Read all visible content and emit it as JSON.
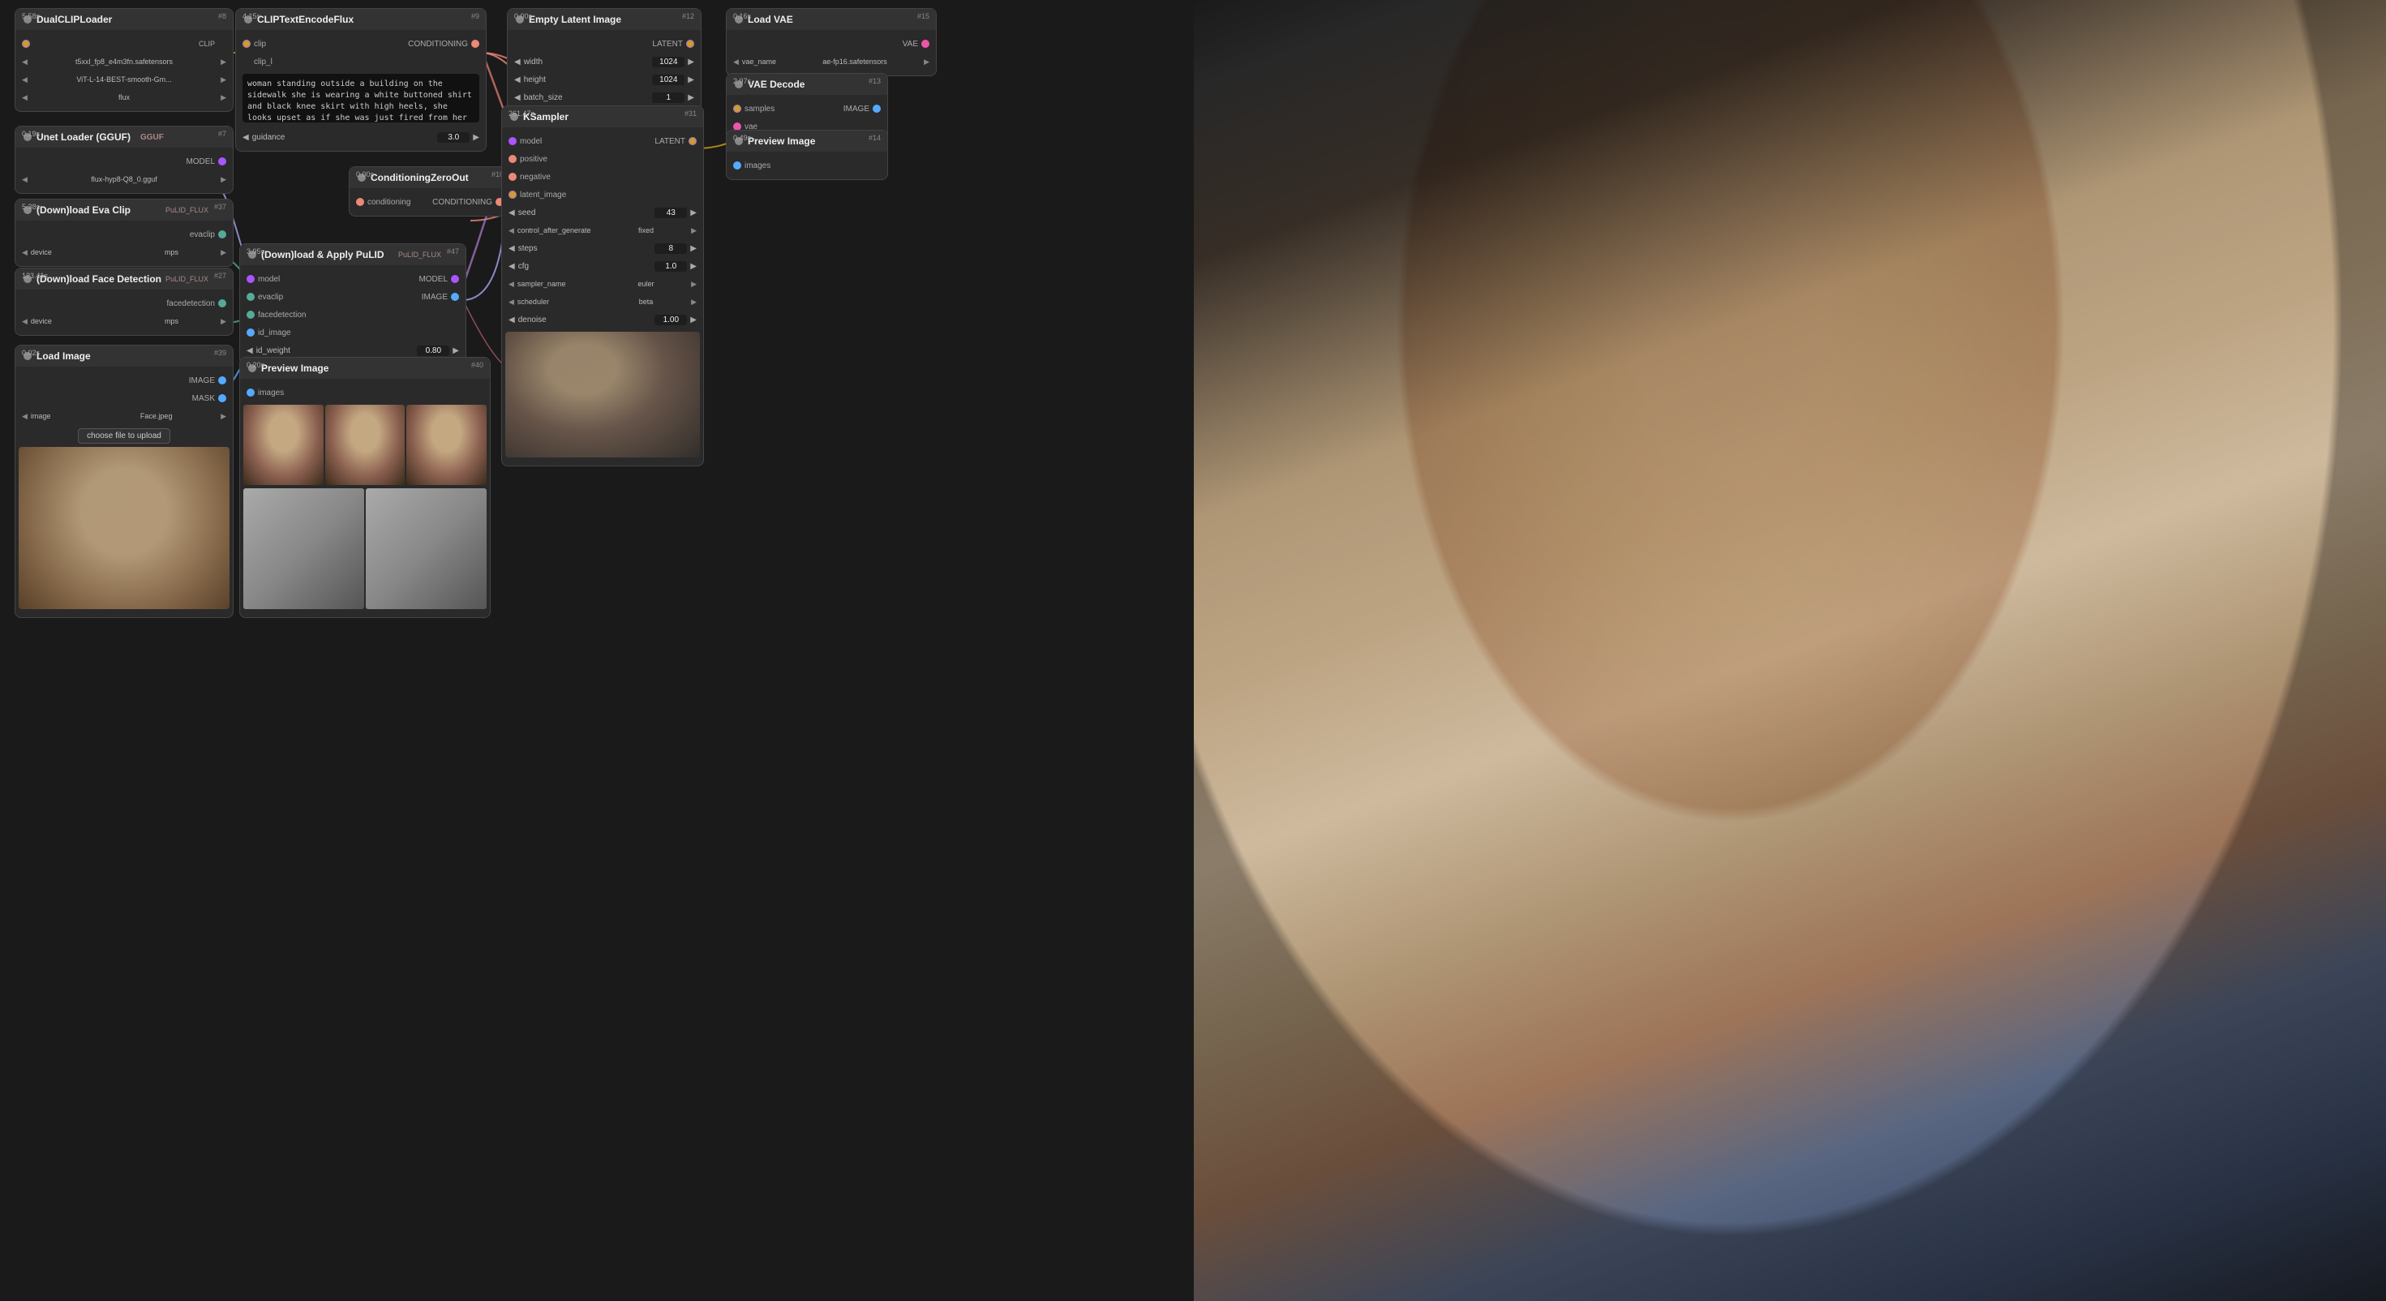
{
  "nodes": {
    "dual_clip": {
      "id": "#8",
      "time": "5.58s",
      "title": "DualCLIPLoader",
      "clip_name1": "t5xxl_fp8_e4m3fn.safetensors",
      "clip_name2": "ViT-L-14-BEST-smooth-Gm...",
      "type": "flux"
    },
    "clip_text": {
      "id": "#9",
      "time": "4.15s",
      "title": "CLIPTextEncodeFlux",
      "clip_port": "clip",
      "clip_l_port": "clip_l",
      "prompt": "woman standing outside a building on the sidewalk she is wearing a white buttoned shirt and black knee skirt with high heels, she looks upset as if she was just fired from her job",
      "guidance_label": "guidance",
      "guidance_val": "3.0"
    },
    "gguf": {
      "id": "#7",
      "time": "0.19s",
      "title": "Unet Loader (GGUF)",
      "unet_name": "flux-hyp8-Q8_0.gguf",
      "label": "GGUF"
    },
    "eva_clip": {
      "id": "#37",
      "time": "5.38s",
      "title": "(Down)load Eva Clip",
      "label": "PuLID_FLUX",
      "evaclip_port": "evaclip",
      "device_label": "device",
      "device_val": "mps"
    },
    "face_detect": {
      "id": "#27",
      "time": "123.41s",
      "title": "(Down)load Face Detection",
      "label": "PuLID_FLUX",
      "facedetection_port": "facedetection",
      "device_label": "device",
      "device_val": "mps"
    },
    "load_image": {
      "id": "#39",
      "time": "0.02s",
      "title": "Load Image",
      "image_label": "image",
      "image_val": "Face.jpeg",
      "upload_label": "choose file to upload"
    },
    "conditioning_zero": {
      "id": "#10",
      "time": "0.00s",
      "title": "ConditioningZeroOut",
      "conditioning_label": "conditioning",
      "conditioning_type": "CONDITIONING"
    },
    "apply_pulid": {
      "id": "#47",
      "time": "3.95s",
      "title": "(Down)load & Apply PuLID",
      "label": "PuLID_FLUX",
      "model_label": "model",
      "evaclip_label": "evaclip",
      "facedetection_label": "facedetection",
      "id_image_label": "id_image",
      "id_weight_label": "id_weight",
      "id_weight_val": "0.80",
      "model_out": "MODEL",
      "image_out": "IMAGE"
    },
    "empty_latent": {
      "id": "#12",
      "time": "0.00s",
      "title": "Empty Latent Image",
      "width_label": "width",
      "width_val": "1024",
      "height_label": "height",
      "height_val": "1024",
      "batch_label": "batch_size",
      "batch_val": "1",
      "latent_out": "LATENT"
    },
    "ksampler": {
      "id": "#31",
      "time": "261.47s",
      "title": "KSampler",
      "model_label": "model",
      "positive_label": "positive",
      "negative_label": "negative",
      "latent_label": "latent_image",
      "seed_label": "seed",
      "seed_val": "43",
      "control_label": "control_after_generate",
      "control_val": "fixed",
      "steps_label": "steps",
      "steps_val": "8",
      "cfg_label": "cfg",
      "cfg_val": "1.0",
      "sampler_label": "sampler_name",
      "sampler_val": "euler",
      "scheduler_label": "scheduler",
      "scheduler_val": "beta",
      "denoise_label": "denoise",
      "denoise_val": "1.00",
      "latent_out": "LATENT"
    },
    "load_vae": {
      "id": "#15",
      "time": "0.16s",
      "title": "Load VAE",
      "vae_name_label": "vae_name",
      "vae_name_val": "ae-fp16.safetensors",
      "vae_out": "VAE"
    },
    "vae_decode": {
      "id": "#13",
      "time": "2.97s",
      "title": "VAE Decode",
      "samples_label": "samples",
      "vae_label": "vae",
      "image_out": "IMAGE"
    },
    "preview_image_out": {
      "id": "#14",
      "time": "0.49s",
      "title": "Preview Image",
      "images_label": "images"
    },
    "preview_image_mid": {
      "id": "#40",
      "time": "0.20s",
      "title": "Preview Image",
      "images_label": "images"
    }
  }
}
